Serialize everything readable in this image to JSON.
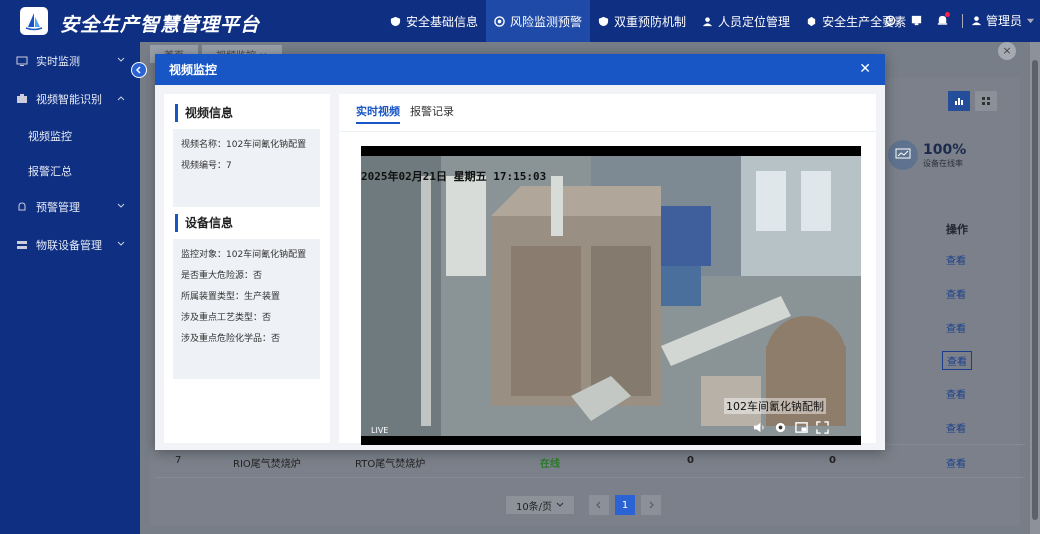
{
  "header": {
    "title": "安全生产智慧管理平台",
    "nav": [
      {
        "label": "安全基础信息",
        "icon": "shield-icon"
      },
      {
        "label": "风险监测预警",
        "icon": "monitor-icon"
      },
      {
        "label": "双重预防机制",
        "icon": "shield-check-icon"
      },
      {
        "label": "人员定位管理",
        "icon": "user-icon"
      },
      {
        "label": "安全生产全要素",
        "icon": "gear-icon"
      }
    ],
    "user": "管理员"
  },
  "sidebar": {
    "items": [
      {
        "label": "实时监测"
      },
      {
        "label": "视频智能识别"
      },
      {
        "label": "视频监控"
      },
      {
        "label": "报警汇总"
      },
      {
        "label": "预警管理"
      },
      {
        "label": "物联设备管理"
      }
    ]
  },
  "main": {
    "tabs": [
      "首页",
      "视频监控 ×"
    ],
    "stat": {
      "value": "100%",
      "label": "设备在线率"
    },
    "ops_header": "操作",
    "ops_link": "查看",
    "row7": {
      "index": "7",
      "name": "RIO尾气焚烧炉",
      "type": "RTO尾气焚烧炉",
      "status": "在线",
      "a": "0",
      "b": "0"
    },
    "pager": {
      "size": "10条/页",
      "page": "1"
    }
  },
  "modal": {
    "title": "视频监控",
    "video_info_title": "视频信息",
    "video_name": "视频名称：102车间氰化钠配置",
    "video_no": "视频编号：7",
    "device_info_title": "设备信息",
    "monitor_obj": "监控对象：102车间氰化钠配置",
    "major_hazard": "是否重大危险源：否",
    "device_type": "所属装置类型：生产装置",
    "key_process": "涉及重点工艺类型：否",
    "key_chem": "涉及重点危险化学品：否",
    "tab_live": "实时视频",
    "tab_alarm": "报警记录",
    "video_timestamp": "2025年02月21日 星期五 17:15:03",
    "video_caption": "102车间氰化钠配制",
    "video_live": "LIVE"
  },
  "colors": {
    "brand": "#0f2f82",
    "accent": "#1856c5",
    "online": "#2c7a2c"
  }
}
